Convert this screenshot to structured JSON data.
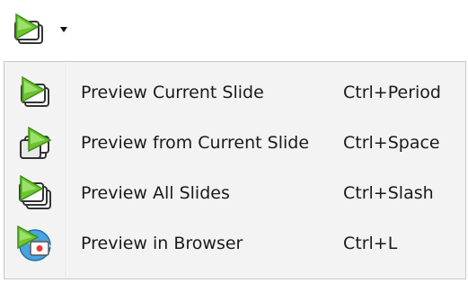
{
  "toolbar": {
    "preview_button_icon": "preview-slide-icon",
    "dropdown_icon": "dropdown-arrow-icon"
  },
  "menu": {
    "items": [
      {
        "label": "Preview Current Slide",
        "shortcut": "Ctrl+Period",
        "icon": "preview-current-slide-icon"
      },
      {
        "label": "Preview from Current Slide",
        "shortcut": "Ctrl+Space",
        "icon": "preview-from-current-slide-icon"
      },
      {
        "label": "Preview All Slides",
        "shortcut": "Ctrl+Slash",
        "icon": "preview-all-slides-icon"
      },
      {
        "label": "Preview in Browser",
        "shortcut": "Ctrl+L",
        "icon": "preview-in-browser-icon"
      }
    ]
  },
  "colors": {
    "accent_green": "#4caf1e",
    "menu_bg": "#f3f3f3",
    "menu_border": "#c8c8c8"
  }
}
